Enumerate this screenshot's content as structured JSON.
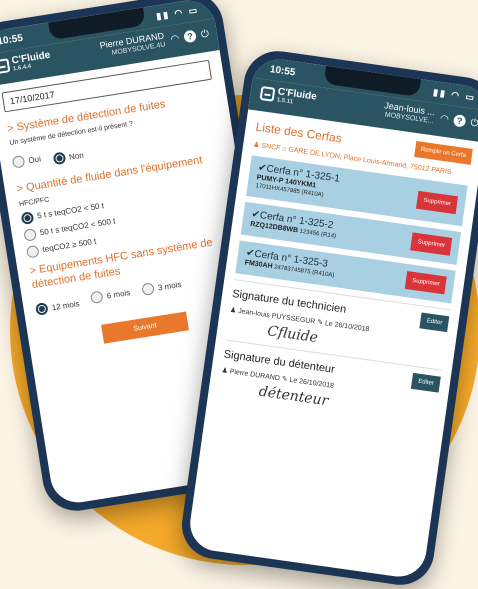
{
  "left_phone": {
    "time": "10:55",
    "app": {
      "name": "C'Fluide",
      "version": "1.6.4.4"
    },
    "user": {
      "name": "Pierre DURAND",
      "org": "MOBYSOLVE.4U"
    },
    "date_value": "17/10/2017",
    "leak_section": {
      "title": "> Système de détection de fuites",
      "question": "Un système de détection est-il présent ?",
      "options": [
        "Oui",
        "Non"
      ],
      "selected": "Non"
    },
    "quantity_section": {
      "title": "> Quantité de fluide dans l'équipement",
      "label": "HFC/PFC",
      "options": [
        "5 t s teqCO2 < 50 t",
        "50 t s teqCO2 < 500 t",
        "teqCO2 ≥ 500 t"
      ],
      "selected": "5 t s teqCO2 < 50 t"
    },
    "equipment_section": {
      "title": "> Equipements HFC sans système de détection de fuites",
      "options": [
        "12 mois",
        "6 mois",
        "3 mois"
      ],
      "selected": "12 mois"
    },
    "submit_label": "Suivant"
  },
  "right_phone": {
    "time": "10:55",
    "app": {
      "name": "C'Fluide",
      "version": "1.5.11"
    },
    "user": {
      "name": "Jean-louis ...",
      "org": "MOBYSOLVE..."
    },
    "list_title": "Liste des Cerfas",
    "fill_button": "Remplir un Cerfa",
    "site": {
      "owner": "SNCF",
      "address": "GARE DE LYON, Place Louis-Armand, 75012 PARIS"
    },
    "cerfas": [
      {
        "name": "Cerfa n° 1-325-1",
        "code": "PUMY-P 140YKM1",
        "detail": "17011HX457985 (R410A)",
        "delete_label": "Supprimer"
      },
      {
        "name": "Cerfa n° 1-325-2",
        "code": "RZQ12DB8WB",
        "detail": "123456 (R14)",
        "delete_label": "Supprimer"
      },
      {
        "name": "Cerfa n° 1-325-3",
        "code": "FM30AH",
        "detail": "24783745875 (R410A)",
        "delete_label": "Supprimer"
      }
    ],
    "technician_signature": {
      "title": "Signature du technicien",
      "edit_label": "Editer",
      "signer": "Jean-louis PUYSSEGUR",
      "date": "Le 26/10/2018",
      "mark": "Cfluide"
    },
    "holder_signature": {
      "title": "Signature du détenteur",
      "edit_label": "Editer",
      "signer": "Pierre DURAND",
      "date": "Le 26/10/2018",
      "mark": "détenteur"
    }
  },
  "colors": {
    "accent": "#e9782d",
    "header": "#2a5461",
    "danger": "#d9343a",
    "card": "#a9d0e2",
    "background_circle": "#f4a92a"
  }
}
